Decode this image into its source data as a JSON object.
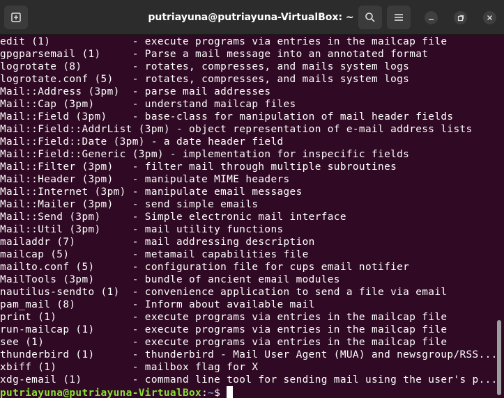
{
  "window": {
    "title": "putriayuna@putriayuna-VirtualBox: ~"
  },
  "icons": {
    "new_tab": "new-tab-icon",
    "search": "search-icon",
    "menu": "hamburger-menu-icon",
    "minimize": "minimize-icon",
    "maximize": "maximize-icon",
    "close": "close-icon"
  },
  "colors": {
    "background": "#300a24",
    "titlebar": "#2c2c2c",
    "prompt_user": "#8ae234",
    "prompt_path": "#729fcf"
  },
  "lines": [
    "edit (1)             - execute programs via entries in the mailcap file",
    "gpgparsemail (1)     - Parse a mail message into an annotated format",
    "logrotate (8)        - rotates, compresses, and mails system logs",
    "logrotate.conf (5)   - rotates, compresses, and mails system logs",
    "Mail::Address (3pm)  - parse mail addresses",
    "Mail::Cap (3pm)      - understand mailcap files",
    "Mail::Field (3pm)    - base-class for manipulation of mail header fields",
    "Mail::Field::AddrList (3pm) - object representation of e-mail address lists",
    "Mail::Field::Date (3pm) - a date header field",
    "Mail::Field::Generic (3pm) - implementation for inspecific fields",
    "Mail::Filter (3pm)   - filter mail through multiple subroutines",
    "Mail::Header (3pm)   - manipulate MIME headers",
    "Mail::Internet (3pm) - manipulate email messages",
    "Mail::Mailer (3pm)   - send simple emails",
    "Mail::Send (3pm)     - Simple electronic mail interface",
    "Mail::Util (3pm)     - mail utility functions",
    "mailaddr (7)         - mail addressing description",
    "mailcap (5)          - metamail capabilities file",
    "mailto.conf (5)      - configuration file for cups email notifier",
    "MailTools (3pm)      - bundle of ancient email modules",
    "nautilus-sendto (1)  - convenience application to send a file via email",
    "pam_mail (8)         - Inform about available mail",
    "print (1)            - execute programs via entries in the mailcap file",
    "run-mailcap (1)      - execute programs via entries in the mailcap file",
    "see (1)              - execute programs via entries in the mailcap file",
    "thunderbird (1)      - thunderbird - Mail User Agent (MUA) and newsgroup/RSS...",
    "xbiff (1)            - mailbox flag for X",
    "xdg-email (1)        - command line tool for sending mail using the user's p..."
  ],
  "prompt": {
    "user_host": "putriayuna@putriayuna-VirtualBox",
    "separator": ":",
    "path": "~",
    "symbol": "$"
  }
}
